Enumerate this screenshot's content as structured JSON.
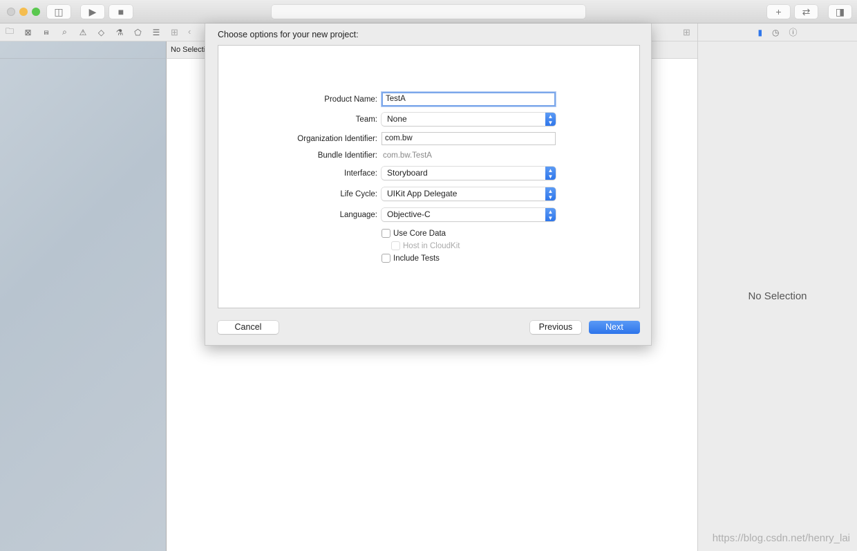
{
  "toolbar": {
    "run_icon": "play-icon",
    "stop_icon": "stop-icon",
    "library_icon": "plus-icon",
    "review_icon": "swap-arrows-icon"
  },
  "navigator": {
    "icons": [
      "folder-icon",
      "source-control-icon",
      "hierarchy-icon",
      "search-icon",
      "warning-icon",
      "test-icon",
      "debug-icon",
      "breakpoint-icon",
      "report-icon"
    ]
  },
  "editor": {
    "header": "No Selection"
  },
  "inspector": {
    "no_selection": "No Selection",
    "accent": "#2f76ea"
  },
  "dialog": {
    "title": "Choose options for your new project:",
    "product_name": {
      "label": "Product Name:",
      "value": "TestA"
    },
    "team": {
      "label": "Team:",
      "value": "None"
    },
    "org_id": {
      "label": "Organization Identifier:",
      "value": "com.bw"
    },
    "bundle_id": {
      "label": "Bundle Identifier:",
      "value": "com.bw.TestA"
    },
    "interface": {
      "label": "Interface:",
      "value": "Storyboard"
    },
    "life_cycle": {
      "label": "Life Cycle:",
      "value": "UIKit App Delegate"
    },
    "language": {
      "label": "Language:",
      "value": "Objective-C"
    },
    "use_core_data": {
      "label": "Use Core Data",
      "checked": false
    },
    "host_in_cloudkit": {
      "label": "Host in CloudKit",
      "checked": false,
      "enabled": false
    },
    "include_tests": {
      "label": "Include Tests",
      "checked": false
    },
    "cancel": "Cancel",
    "previous": "Previous",
    "next": "Next"
  },
  "watermark": "https://blog.csdn.net/henry_lai"
}
